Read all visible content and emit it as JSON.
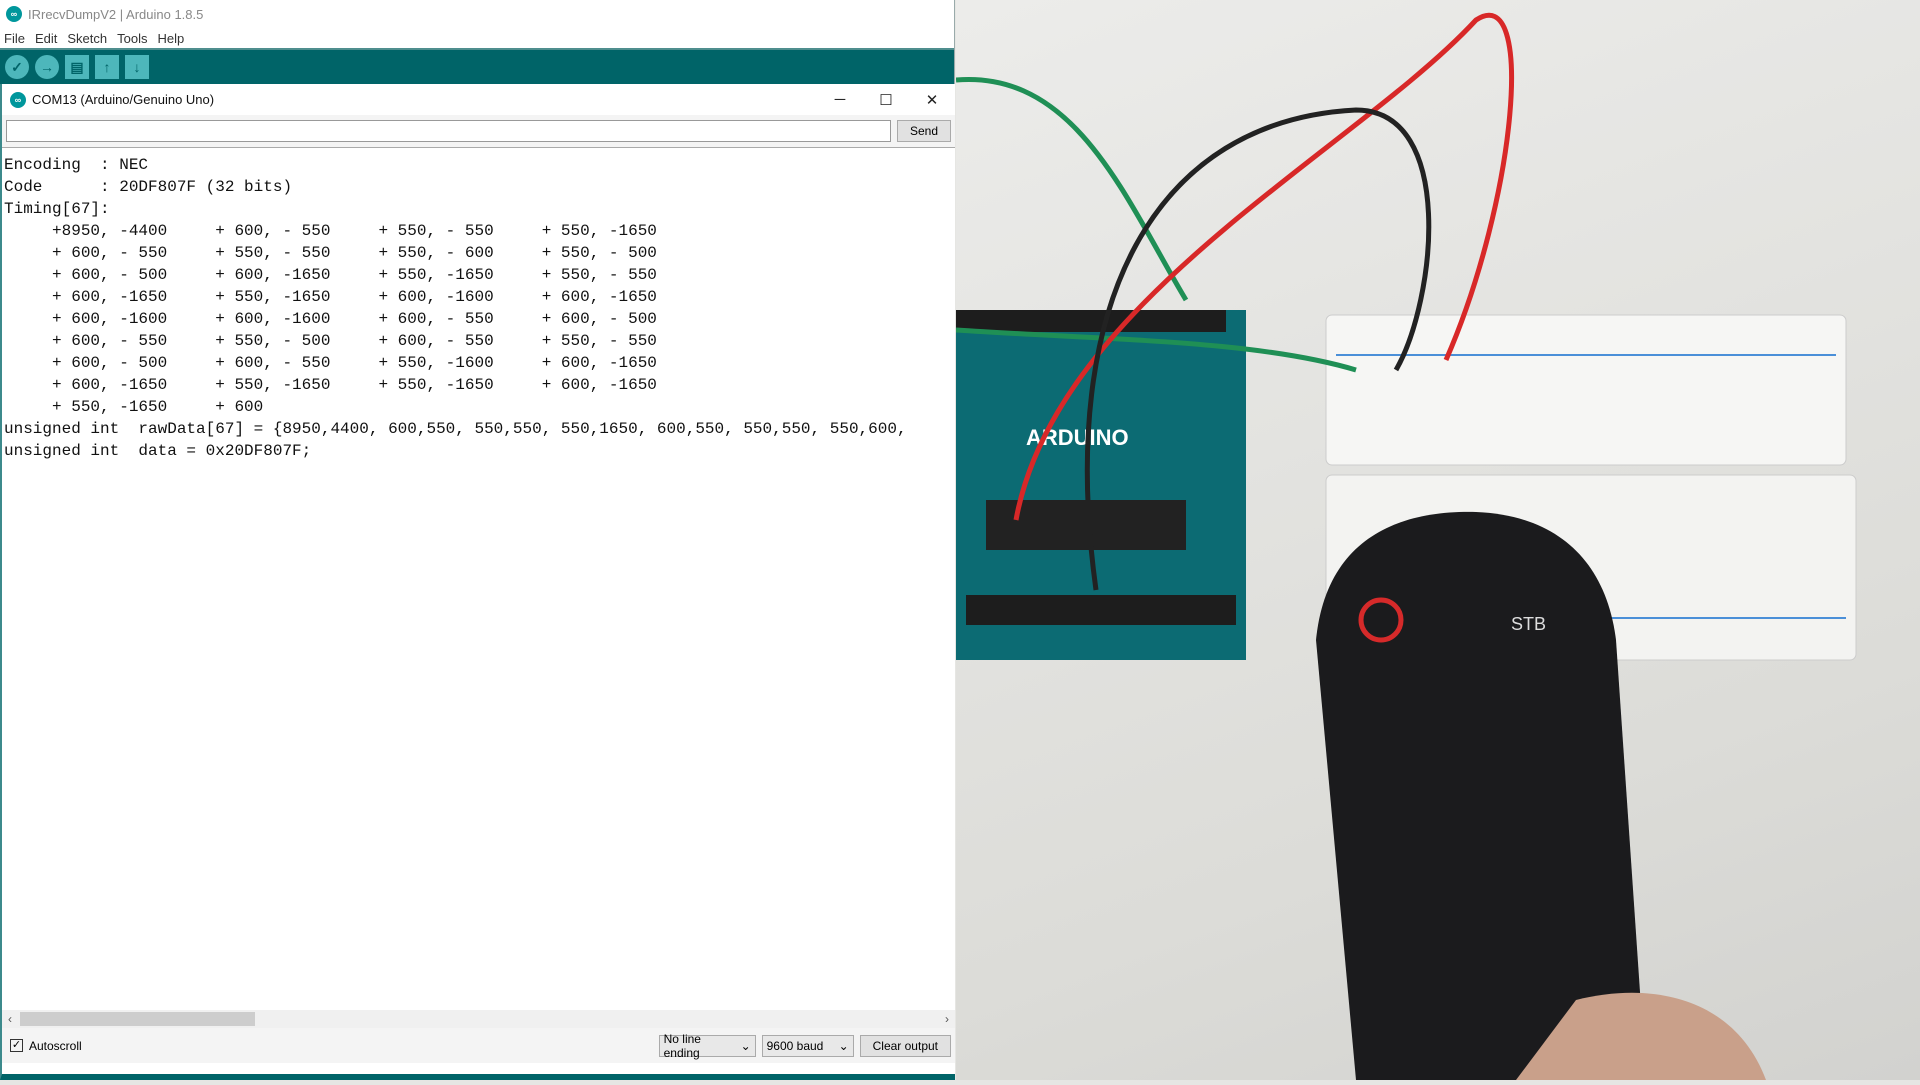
{
  "window_title": "IRrecvDumpV2 | Arduino 1.8.5",
  "menu": [
    "File",
    "Edit",
    "Sketch",
    "Tools",
    "Help"
  ],
  "toolbar": {
    "verify": "verify-icon",
    "upload": "upload-icon",
    "new": "new-icon",
    "open": "open-icon",
    "save": "save-icon"
  },
  "serial": {
    "title": "COM13 (Arduino/Genuino Uno)",
    "input_value": "",
    "send_label": "Send",
    "output_lines": [
      "Encoding  : NEC",
      "Code      : 20DF807F (32 bits)",
      "Timing[67]:",
      "     +8950, -4400     + 600, - 550     + 550, - 550     + 550, -1650",
      "     + 600, - 550     + 550, - 550     + 550, - 600     + 550, - 500",
      "     + 600, - 500     + 600, -1650     + 550, -1650     + 550, - 550",
      "     + 600, -1650     + 550, -1650     + 600, -1600     + 600, -1650",
      "     + 600, -1600     + 600, -1600     + 600, - 550     + 600, - 500",
      "     + 600, - 550     + 550, - 500     + 600, - 550     + 550, - 550",
      "     + 600, - 500     + 600, - 550     + 550, -1600     + 600, -1650",
      "     + 600, -1650     + 550, -1650     + 550, -1650     + 600, -1650",
      "     + 550, -1650     + 600",
      "unsigned int  rawData[67] = {8950,4400, 600,550, 550,550, 550,1650, 600,550, 550,550, 550,600,",
      "unsigned int  data = 0x20DF807F;"
    ],
    "autoscroll_label": "Autoscroll",
    "autoscroll_checked": true,
    "line_ending": "No line ending",
    "baud": "9600 baud",
    "clear_label": "Clear output"
  },
  "colors": {
    "teal": "#006468",
    "accent": "#00979c"
  }
}
